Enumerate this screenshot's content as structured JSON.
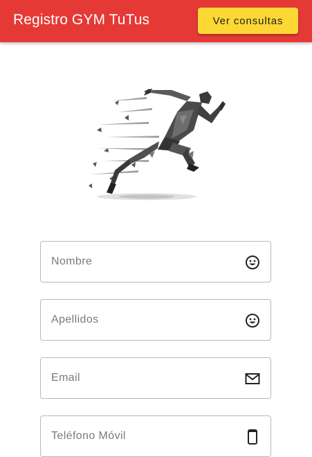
{
  "appbar": {
    "title": "Registro GYM TuTus",
    "consult_button_label": "Ver consultas",
    "color": "#e53935",
    "button_color": "#fdd835"
  },
  "hero": {
    "image": "sprinting-runner-illustration"
  },
  "form": {
    "fields": [
      {
        "placeholder": "Nombre",
        "value": "",
        "icon": "smiley-icon"
      },
      {
        "placeholder": "Apellidos",
        "value": "",
        "icon": "smiley-icon"
      },
      {
        "placeholder": "Email",
        "value": "",
        "icon": "mail-icon"
      },
      {
        "placeholder": "Teléfono Móvil",
        "value": "",
        "icon": "phone-icon"
      }
    ]
  }
}
